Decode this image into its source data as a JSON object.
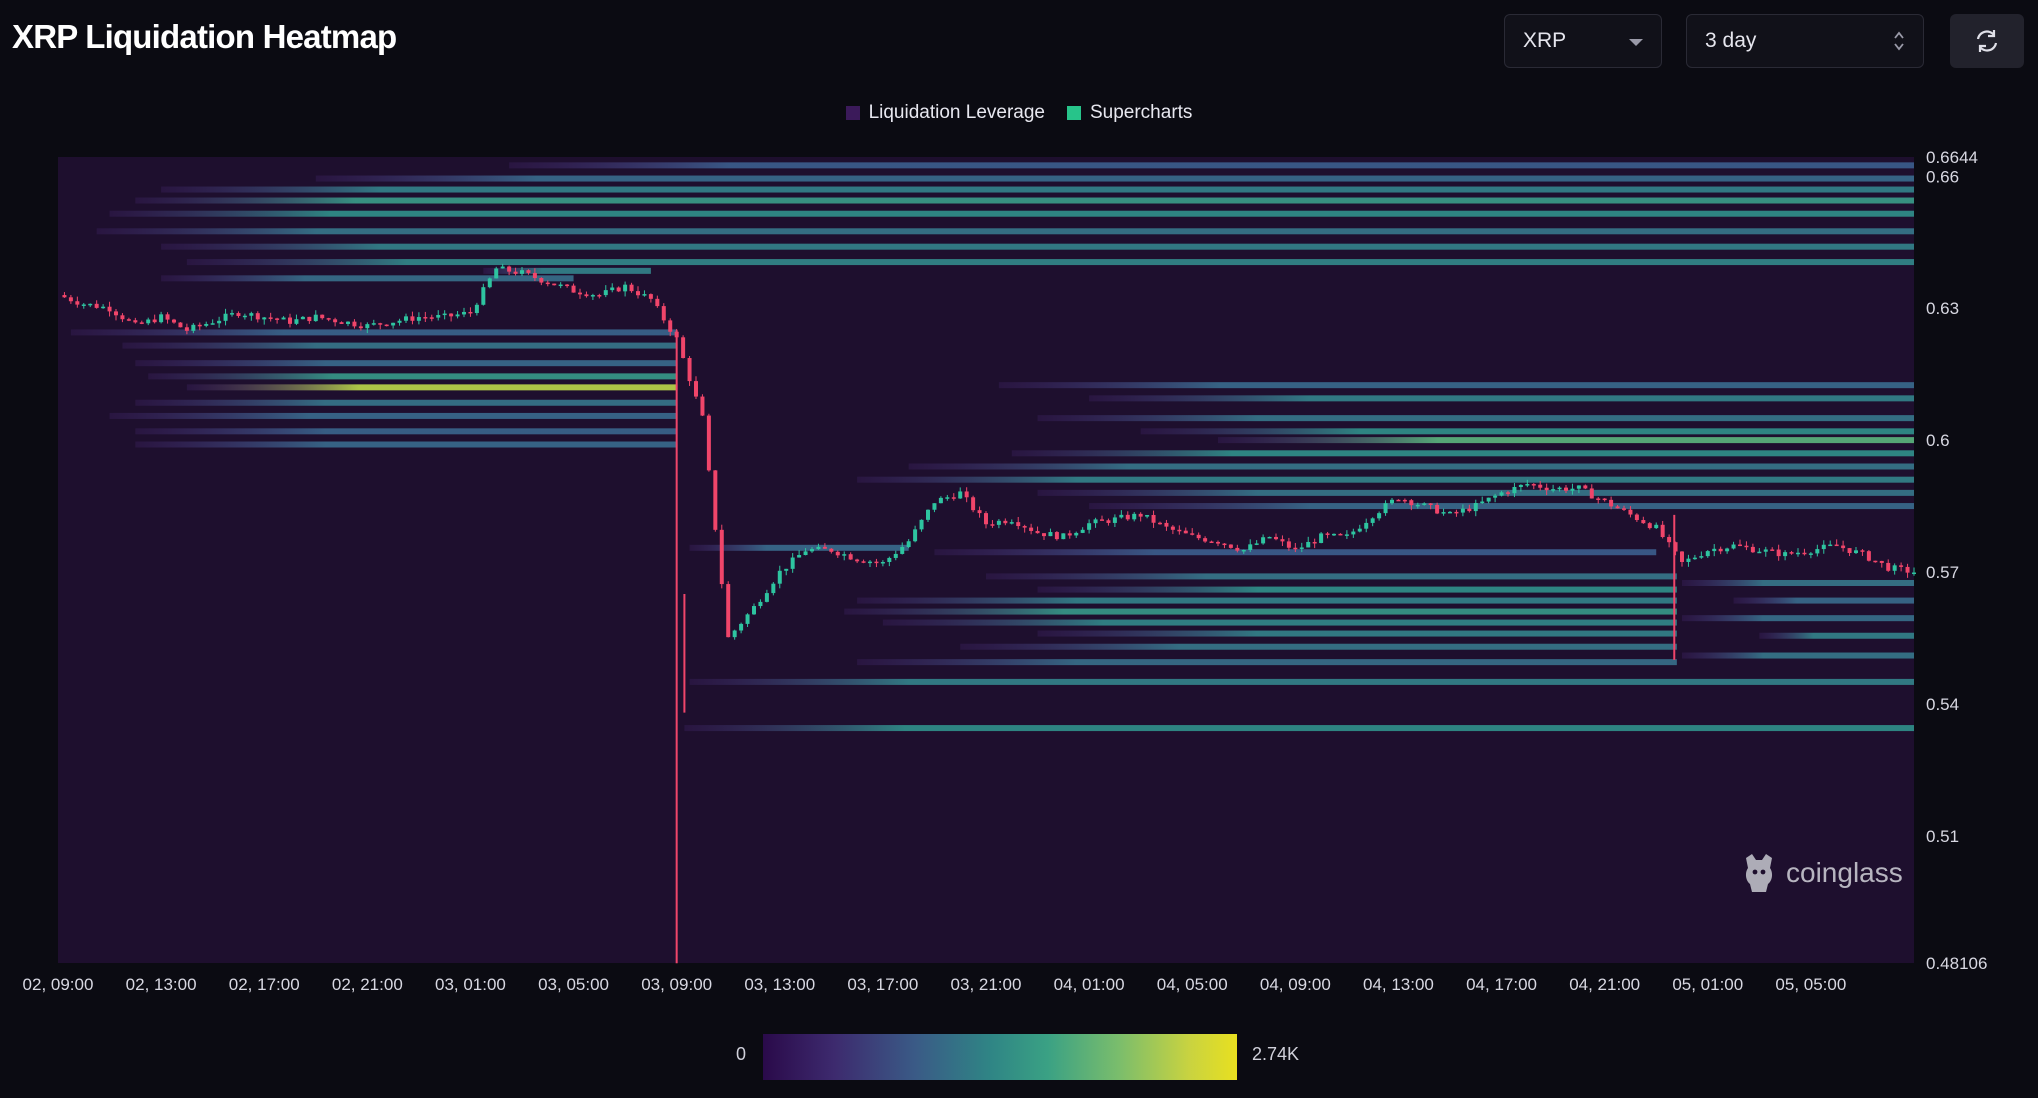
{
  "header": {
    "title": "XRP Liquidation Heatmap",
    "coin_select": "XRP",
    "range_select": "3 day",
    "refresh_icon": "refresh-icon"
  },
  "legend": [
    {
      "label": "Liquidation Leverage",
      "color": "#3b1a5a"
    },
    {
      "label": "Supercharts",
      "color": "#27c48a"
    }
  ],
  "colors": {
    "background": "#0b0b12",
    "plot_background": "#1e0f2e",
    "candle_up": "#2ec4a0",
    "candle_down": "#f0456a",
    "colorscale_low": "#2a0a4a",
    "colorscale_high": "#e8e020"
  },
  "watermark": "coinglass",
  "chart_data": {
    "type": "heatmap",
    "title": "XRP Liquidation Heatmap",
    "legend_placement": "top-center",
    "grid": false,
    "x_tick_labels": [
      "02, 09:00",
      "02, 13:00",
      "02, 17:00",
      "02, 21:00",
      "03, 01:00",
      "03, 05:00",
      "03, 09:00",
      "03, 13:00",
      "03, 17:00",
      "03, 21:00",
      "04, 01:00",
      "04, 05:00",
      "04, 09:00",
      "04, 13:00",
      "04, 17:00",
      "04, 21:00",
      "05, 01:00",
      "05, 05:00"
    ],
    "y_tick_labels": [
      "0.6644",
      "0.66",
      "0.63",
      "0.6",
      "0.57",
      "0.54",
      "0.51",
      "0.48106"
    ],
    "ylim": [
      0.48106,
      0.6644
    ],
    "xlim_hours": [
      0,
      72
    ],
    "colorscale": {
      "min": 0,
      "max": 2740,
      "min_label": "0",
      "max_label": "2.74K"
    },
    "price_path": [
      [
        0,
        0.633
      ],
      [
        1,
        0.631
      ],
      [
        2,
        0.63
      ],
      [
        3,
        0.626
      ],
      [
        4,
        0.628
      ],
      [
        5,
        0.625
      ],
      [
        6,
        0.627
      ],
      [
        7,
        0.629
      ],
      [
        8,
        0.628
      ],
      [
        9,
        0.627
      ],
      [
        10,
        0.628
      ],
      [
        11,
        0.627
      ],
      [
        12,
        0.626
      ],
      [
        13,
        0.627
      ],
      [
        14,
        0.628
      ],
      [
        15,
        0.628
      ],
      [
        16,
        0.629
      ],
      [
        17,
        0.639
      ],
      [
        18,
        0.638
      ],
      [
        19,
        0.636
      ],
      [
        20,
        0.634
      ],
      [
        21,
        0.633
      ],
      [
        22,
        0.635
      ],
      [
        23,
        0.632
      ],
      [
        24,
        0.623
      ],
      [
        25,
        0.605
      ],
      [
        26,
        0.555
      ],
      [
        27,
        0.562
      ],
      [
        28,
        0.57
      ],
      [
        29,
        0.575
      ],
      [
        30,
        0.575
      ],
      [
        31,
        0.573
      ],
      [
        32,
        0.572
      ],
      [
        33,
        0.577
      ],
      [
        34,
        0.586
      ],
      [
        35,
        0.588
      ],
      [
        36,
        0.581
      ],
      [
        37,
        0.582
      ],
      [
        38,
        0.579
      ],
      [
        39,
        0.578
      ],
      [
        40,
        0.581
      ],
      [
        41,
        0.582
      ],
      [
        42,
        0.583
      ],
      [
        43,
        0.58
      ],
      [
        44,
        0.578
      ],
      [
        45,
        0.577
      ],
      [
        46,
        0.575
      ],
      [
        47,
        0.578
      ],
      [
        48,
        0.575
      ],
      [
        49,
        0.578
      ],
      [
        50,
        0.578
      ],
      [
        51,
        0.583
      ],
      [
        52,
        0.587
      ],
      [
        53,
        0.585
      ],
      [
        54,
        0.583
      ],
      [
        55,
        0.585
      ],
      [
        56,
        0.588
      ],
      [
        57,
        0.59
      ],
      [
        58,
        0.589
      ],
      [
        59,
        0.589
      ],
      [
        60,
        0.586
      ],
      [
        61,
        0.583
      ],
      [
        62,
        0.58
      ],
      [
        63,
        0.572
      ],
      [
        64,
        0.575
      ],
      [
        65,
        0.576
      ],
      [
        66,
        0.575
      ],
      [
        67,
        0.574
      ],
      [
        68,
        0.575
      ],
      [
        69,
        0.576
      ],
      [
        70,
        0.574
      ],
      [
        71,
        0.571
      ],
      [
        72,
        0.57
      ]
    ],
    "price_spikes": [
      {
        "hour": 24.0,
        "low": 0.481,
        "high": 0.625
      },
      {
        "hour": 24.3,
        "low": 0.538,
        "high": 0.565
      },
      {
        "hour": 62.7,
        "low": 0.55,
        "high": 0.583
      }
    ],
    "liquidation_bands": [
      {
        "price": 0.6625,
        "start_hour": 17.5,
        "intensity": 0.35
      },
      {
        "price": 0.6595,
        "start_hour": 10.0,
        "intensity": 0.4
      },
      {
        "price": 0.657,
        "start_hour": 4.0,
        "intensity": 0.5
      },
      {
        "price": 0.6545,
        "start_hour": 3.0,
        "intensity": 0.62
      },
      {
        "price": 0.6515,
        "start_hour": 2.0,
        "intensity": 0.55
      },
      {
        "price": 0.6475,
        "start_hour": 1.5,
        "intensity": 0.45
      },
      {
        "price": 0.644,
        "start_hour": 4.0,
        "intensity": 0.5
      },
      {
        "price": 0.6405,
        "start_hour": 5.0,
        "intensity": 0.52
      },
      {
        "price": 0.6385,
        "start_hour": 16.5,
        "intensity": 0.5,
        "end_hour": 23.0
      },
      {
        "price": 0.6368,
        "start_hour": 4.0,
        "intensity": 0.42,
        "end_hour": 20.0
      },
      {
        "price": 0.6245,
        "start_hour": 0.5,
        "intensity": 0.38,
        "end_hour": 24.0
      },
      {
        "price": 0.6215,
        "start_hour": 2.5,
        "intensity": 0.45,
        "end_hour": 24.0
      },
      {
        "price": 0.6175,
        "start_hour": 3.0,
        "intensity": 0.4,
        "end_hour": 24.0
      },
      {
        "price": 0.6145,
        "start_hour": 3.5,
        "intensity": 0.6,
        "end_hour": 24.0
      },
      {
        "price": 0.612,
        "start_hour": 5.0,
        "intensity": 0.9,
        "end_hour": 24.0
      },
      {
        "price": 0.6085,
        "start_hour": 3.0,
        "intensity": 0.45,
        "end_hour": 24.0
      },
      {
        "price": 0.6055,
        "start_hour": 2.0,
        "intensity": 0.4,
        "end_hour": 24.0
      },
      {
        "price": 0.602,
        "start_hour": 3.0,
        "intensity": 0.38,
        "end_hour": 24.0
      },
      {
        "price": 0.599,
        "start_hour": 3.0,
        "intensity": 0.4,
        "end_hour": 24.0
      },
      {
        "price": 0.6125,
        "start_hour": 36.5,
        "intensity": 0.4
      },
      {
        "price": 0.6095,
        "start_hour": 40.0,
        "intensity": 0.5
      },
      {
        "price": 0.605,
        "start_hour": 38.0,
        "intensity": 0.45
      },
      {
        "price": 0.602,
        "start_hour": 42.0,
        "intensity": 0.55
      },
      {
        "price": 0.6,
        "start_hour": 45.0,
        "intensity": 0.75
      },
      {
        "price": 0.597,
        "start_hour": 37.0,
        "intensity": 0.55
      },
      {
        "price": 0.594,
        "start_hour": 33.0,
        "intensity": 0.45
      },
      {
        "price": 0.591,
        "start_hour": 31.0,
        "intensity": 0.5
      },
      {
        "price": 0.588,
        "start_hour": 38.0,
        "intensity": 0.45
      },
      {
        "price": 0.585,
        "start_hour": 40.0,
        "intensity": 0.4
      },
      {
        "price": 0.5755,
        "start_hour": 24.5,
        "intensity": 0.4,
        "end_hour": 33.0
      },
      {
        "price": 0.5745,
        "start_hour": 34.0,
        "intensity": 0.35,
        "end_hour": 62.0
      },
      {
        "price": 0.569,
        "start_hour": 36.0,
        "intensity": 0.45,
        "end_hour": 62.8
      },
      {
        "price": 0.566,
        "start_hour": 38.0,
        "intensity": 0.55,
        "end_hour": 62.8
      },
      {
        "price": 0.5635,
        "start_hour": 31.0,
        "intensity": 0.5,
        "end_hour": 62.8
      },
      {
        "price": 0.561,
        "start_hour": 30.5,
        "intensity": 0.6,
        "end_hour": 62.8
      },
      {
        "price": 0.5585,
        "start_hour": 32.0,
        "intensity": 0.52,
        "end_hour": 62.8
      },
      {
        "price": 0.556,
        "start_hour": 38.0,
        "intensity": 0.5,
        "end_hour": 62.8
      },
      {
        "price": 0.553,
        "start_hour": 35.0,
        "intensity": 0.45,
        "end_hour": 62.8
      },
      {
        "price": 0.5495,
        "start_hour": 31.0,
        "intensity": 0.42,
        "end_hour": 62.8
      },
      {
        "price": 0.5675,
        "start_hour": 63.0,
        "intensity": 0.45
      },
      {
        "price": 0.5635,
        "start_hour": 65.0,
        "intensity": 0.4
      },
      {
        "price": 0.5595,
        "start_hour": 63.0,
        "intensity": 0.42
      },
      {
        "price": 0.5555,
        "start_hour": 66.0,
        "intensity": 0.5
      },
      {
        "price": 0.551,
        "start_hour": 63.0,
        "intensity": 0.45
      },
      {
        "price": 0.545,
        "start_hour": 24.5,
        "intensity": 0.5
      },
      {
        "price": 0.5345,
        "start_hour": 24.3,
        "intensity": 0.55
      }
    ]
  }
}
